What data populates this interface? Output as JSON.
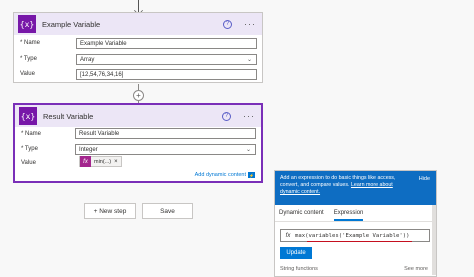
{
  "card1": {
    "icon": "{x}",
    "title": "Example Variable",
    "name_label": "* Name",
    "name_value": "Example Variable",
    "type_label": "* Type",
    "type_value": "Array",
    "value_label": "Value",
    "value_value": "[12,54,76,34,16]"
  },
  "card2": {
    "icon": "{x}",
    "title": "Result Variable",
    "name_label": "* Name",
    "name_value": "Result Variable",
    "type_label": "* Type",
    "type_value": "Integer",
    "value_label": "Value",
    "token_icon": "fx",
    "token_label": "min(...)",
    "token_close": "×",
    "add_dynamic": "Add dynamic content",
    "add_dynamic_badge": "⚡"
  },
  "help_icon": "?",
  "more_icon": "···",
  "plus_icon": "+",
  "buttons": {
    "new_step": "+ New step",
    "save": "Save"
  },
  "popup": {
    "description_pre": "Add an expression to do basic things like access, convert, and compare values. ",
    "description_link": "Learn more about dynamic content.",
    "hide": "Hide",
    "tab_dynamic": "Dynamic content",
    "tab_expression": "Expression",
    "expr_icon": "fx",
    "expression": "max(variables('Example Variable'))",
    "update": "Update",
    "string_functions": "String functions",
    "see_more": "See more"
  },
  "colors": {
    "variable_icon": "#7717a8",
    "header_bg": "#ece6f6",
    "selected_border": "#7a2fb8",
    "accent": "#0078d4",
    "token_icon": "#a4268e",
    "error_underline": "#c50f1f"
  }
}
